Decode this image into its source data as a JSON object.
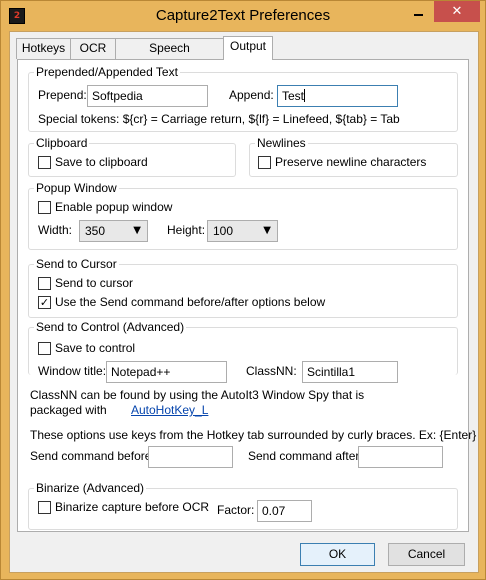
{
  "window": {
    "title": "Capture2Text Preferences",
    "icon_text": "2",
    "close_glyph": "✕"
  },
  "tabs": [
    "Hotkeys",
    "OCR",
    "Speech Recognition",
    "Output"
  ],
  "active_tab": "Output",
  "prepended": {
    "group_label": "Prepended/Appended Text",
    "prepend_label": "Prepend:",
    "prepend_value": "Softpedia",
    "append_label": "Append:",
    "append_value": "Test",
    "tokens_text": "Special tokens:  ${cr} = Carriage return,  ${lf} = Linefeed,  ${tab} = Tab"
  },
  "clipboard": {
    "group_label": "Clipboard",
    "save_label": "Save to clipboard",
    "save_checked": false
  },
  "newlines": {
    "group_label": "Newlines",
    "preserve_label": "Preserve newline characters",
    "preserve_checked": false
  },
  "popup": {
    "group_label": "Popup Window",
    "enable_label": "Enable popup window",
    "enable_checked": false,
    "width_label": "Width:",
    "width_value": "350",
    "height_label": "Height:",
    "height_value": "100"
  },
  "cursor": {
    "group_label": "Send to Cursor",
    "send_label": "Send to cursor",
    "send_checked": false,
    "use_send_label": "Use the Send command before/after options below",
    "use_send_checked": true
  },
  "control": {
    "group_label": "Send to Control (Advanced)",
    "save_label": "Save to control",
    "save_checked": false,
    "window_title_label": "Window title:",
    "window_title_value": "Notepad++",
    "classnn_label": "ClassNN:",
    "classnn_value": "Scintilla1",
    "info_line1": "ClassNN can be found by using the AutoIt3 Window Spy that is",
    "info_line2": "packaged with",
    "link_text": "AutoHotKey_L",
    "options_text": "These options use keys from the Hotkey tab surrounded by curly braces. Ex: {Enter}",
    "before_label": "Send command before:",
    "before_value": "",
    "after_label": "Send command after:",
    "after_value": ""
  },
  "binarize": {
    "group_label": "Binarize (Advanced)",
    "capture_label": "Binarize capture before OCR",
    "capture_checked": false,
    "factor_label": "Factor:",
    "factor_value": "0.07"
  },
  "buttons": {
    "ok": "OK",
    "cancel": "Cancel"
  },
  "colors": {
    "frame": "#e8b55c",
    "close": "#c7504c",
    "link": "#0645ad",
    "focus": "#3c7fb1"
  }
}
